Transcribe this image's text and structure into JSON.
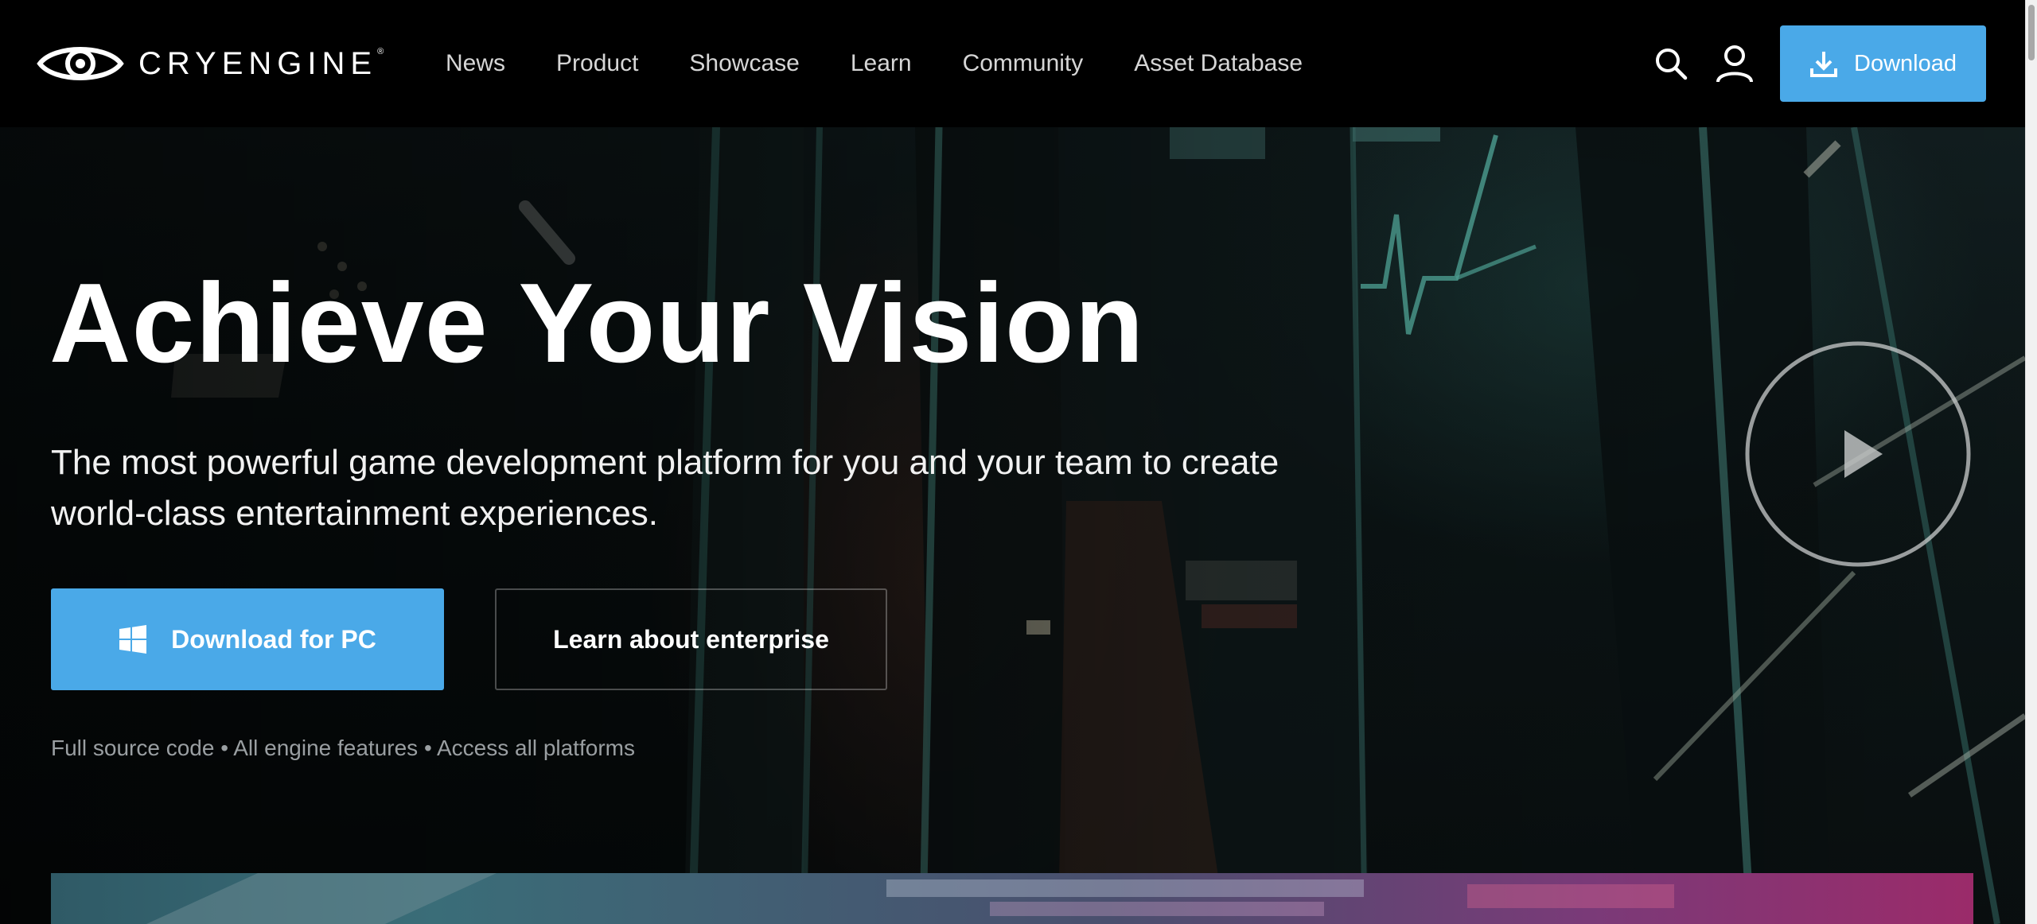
{
  "brand": {
    "name": "CRYENGINE",
    "registered_mark": "®"
  },
  "nav": {
    "links": [
      "News",
      "Product",
      "Showcase",
      "Learn",
      "Community",
      "Asset Database"
    ],
    "download_label": "Download",
    "icons": {
      "search": "search-icon",
      "account": "user-icon",
      "download": "download-icon"
    }
  },
  "hero": {
    "title": "Achieve Your Vision",
    "subtitle": "The most powerful game development platform for you and your team to create world-class entertainment experiences.",
    "primary_button": "Download for PC",
    "secondary_button": "Learn about enterprise",
    "features": "Full source code • All engine features • Access all platforms",
    "icons": {
      "primary": "windows-icon",
      "video": "play-icon"
    }
  },
  "colors": {
    "accent": "#4aa9e8",
    "nav_background": "#000000",
    "muted_text": "#9a9fa2"
  }
}
